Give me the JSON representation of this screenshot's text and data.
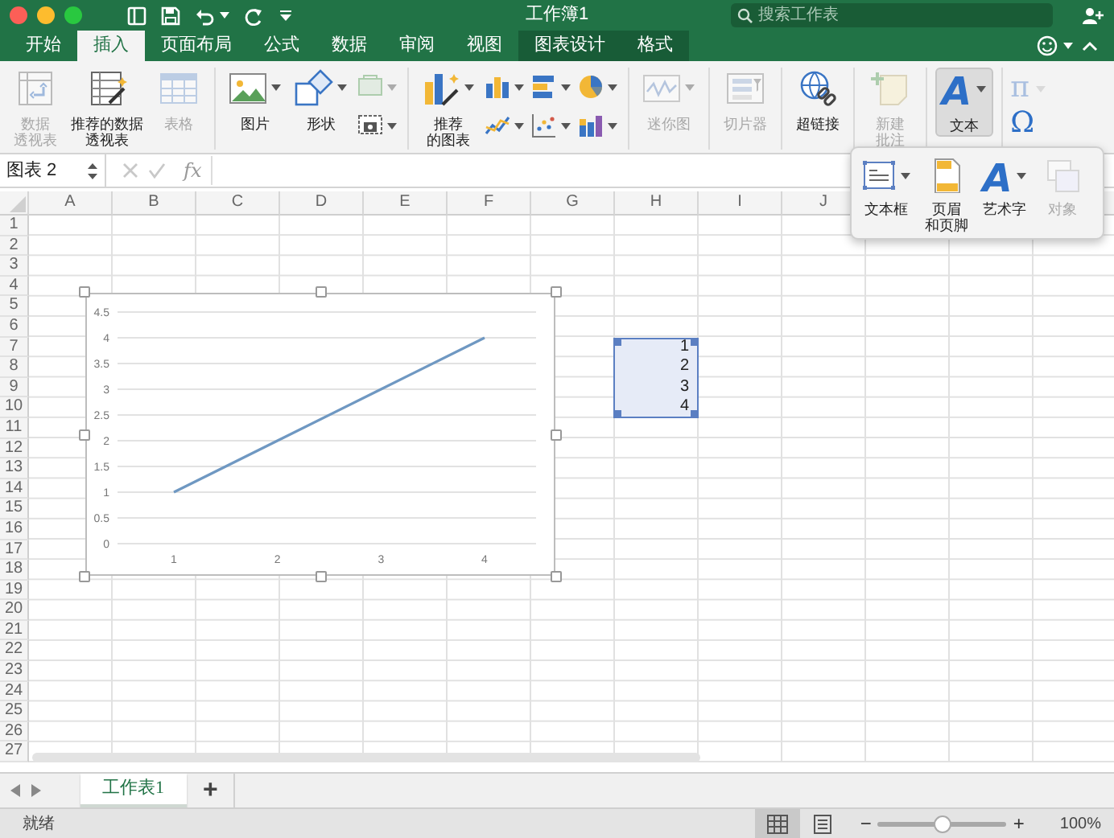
{
  "window": {
    "title": "工作簿1"
  },
  "search": {
    "placeholder": "搜索工作表"
  },
  "tabs": [
    {
      "label": "开始",
      "selected": false,
      "kind": "main"
    },
    {
      "label": "插入",
      "selected": true,
      "kind": "main"
    },
    {
      "label": "页面布局",
      "selected": false,
      "kind": "main"
    },
    {
      "label": "公式",
      "selected": false,
      "kind": "main"
    },
    {
      "label": "数据",
      "selected": false,
      "kind": "main"
    },
    {
      "label": "审阅",
      "selected": false,
      "kind": "main"
    },
    {
      "label": "视图",
      "selected": false,
      "kind": "main"
    },
    {
      "label": "图表设计",
      "selected": false,
      "kind": "context"
    },
    {
      "label": "格式",
      "selected": false,
      "kind": "context"
    }
  ],
  "ribbon_groups": [
    {
      "items": [
        {
          "kind": "large",
          "label": [
            "数据",
            "透视表"
          ],
          "disabled": true,
          "dropdown": false,
          "pressed": false
        },
        {
          "kind": "large",
          "label": [
            "推荐的数据",
            "透视表"
          ],
          "disabled": false,
          "dropdown": false,
          "pressed": false
        },
        {
          "kind": "large",
          "label": "表格",
          "disabled": true,
          "dropdown": false,
          "pressed": false
        }
      ]
    },
    {
      "items": [
        {
          "kind": "large",
          "label": "图片",
          "disabled": false,
          "dropdown": true,
          "pressed": false
        },
        {
          "kind": "large",
          "label": "形状",
          "disabled": false,
          "dropdown": true,
          "pressed": false
        },
        {
          "kind": "stack",
          "buttons": [
            {
              "disabled": true,
              "dropdown": true
            },
            {
              "disabled": false,
              "dropdown": true
            }
          ]
        }
      ]
    },
    {
      "items": [
        {
          "kind": "large",
          "label": [
            "推荐",
            "的图表"
          ],
          "disabled": false,
          "dropdown": true,
          "pressed": false
        },
        {
          "kind": "stack",
          "buttons": [
            {
              "disabled": false,
              "dropdown": true
            },
            {
              "disabled": false,
              "dropdown": true
            }
          ]
        },
        {
          "kind": "stack",
          "buttons": [
            {
              "disabled": false,
              "dropdown": true
            },
            {
              "disabled": false,
              "dropdown": true
            }
          ]
        },
        {
          "kind": "stack",
          "buttons": [
            {
              "disabled": false,
              "dropdown": true
            },
            {
              "disabled": false,
              "dropdown": true
            }
          ]
        }
      ]
    },
    {
      "items": [
        {
          "kind": "large",
          "label": "迷你图",
          "disabled": true,
          "dropdown": true,
          "pressed": false
        }
      ]
    },
    {
      "items": [
        {
          "kind": "large",
          "label": "切片器",
          "disabled": true,
          "dropdown": false,
          "pressed": false
        }
      ]
    },
    {
      "items": [
        {
          "kind": "large",
          "label": "超链接",
          "disabled": false,
          "dropdown": false,
          "pressed": false
        }
      ]
    },
    {
      "items": [
        {
          "kind": "large",
          "label": [
            "新建",
            "批注"
          ],
          "disabled": true,
          "dropdown": false,
          "pressed": false
        }
      ]
    },
    {
      "items": [
        {
          "kind": "glyph",
          "glyph": "A",
          "label": "文本",
          "disabled": false,
          "dropdown": true,
          "pressed": true
        }
      ]
    },
    {
      "items": [
        {
          "kind": "charstack",
          "buttons": [
            {
              "glyph": "π",
              "disabled": true,
              "dropdown": true
            },
            {
              "glyph": "Ω",
              "disabled": false,
              "dropdown": false
            }
          ]
        }
      ]
    }
  ],
  "formula_bar": {
    "name_box": "图表 2",
    "function_label": "fx"
  },
  "text_menu": [
    {
      "kind": "textbox",
      "label": "文本框",
      "disabled": false,
      "dropdown": true
    },
    {
      "kind": "header",
      "label": [
        "页眉",
        "和页脚"
      ],
      "disabled": false,
      "dropdown": false
    },
    {
      "kind": "glyph",
      "glyph": "A",
      "label": "艺术字",
      "disabled": false,
      "dropdown": true
    },
    {
      "kind": "object",
      "label": "对象",
      "disabled": true,
      "dropdown": false
    }
  ],
  "columns": [
    "A",
    "B",
    "C",
    "D",
    "E",
    "F",
    "G",
    "H",
    "I",
    "J"
  ],
  "rows": [
    "1",
    "2",
    "3",
    "4",
    "5",
    "6",
    "7",
    "8",
    "9",
    "10",
    "11",
    "12",
    "13",
    "14",
    "15",
    "16",
    "17",
    "18",
    "19",
    "20",
    "21",
    "22",
    "23",
    "24",
    "25",
    "26",
    "27"
  ],
  "selected_range": {
    "values": [
      "1",
      "2",
      "3",
      "4"
    ]
  },
  "chart": {
    "chart_data": {
      "type": "line",
      "categories": [
        "1",
        "2",
        "3",
        "4"
      ],
      "series": [
        {
          "color": "#6f98c2",
          "values": [
            1,
            2,
            3,
            4
          ]
        }
      ],
      "ylim": [
        0,
        4.5
      ],
      "grid": true,
      "yticks": [
        0,
        0.5,
        1,
        1.5,
        2,
        2.5,
        3,
        3.5,
        4,
        4.5
      ]
    }
  },
  "sheet_tabs": [
    {
      "label": "工作表1",
      "selected": true
    }
  ],
  "add_sheet": "+",
  "status_bar": {
    "text": "就绪",
    "views": [
      {
        "selected": true
      },
      {
        "selected": false
      }
    ],
    "zoom_out": "−",
    "zoom_in": "+",
    "zoom": {
      "level": 0.5
    },
    "zoom_text": "100%"
  }
}
